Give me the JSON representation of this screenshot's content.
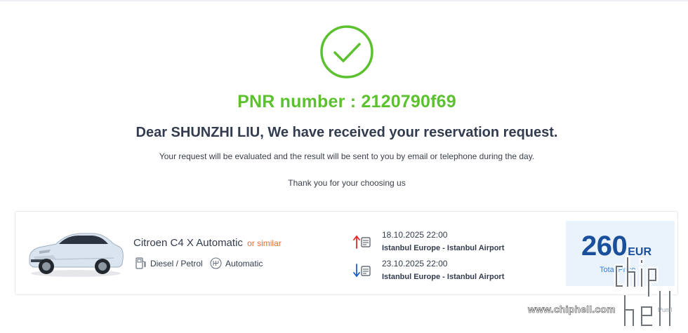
{
  "status": {
    "icon": "check-circle-icon",
    "color": "#5cc12f"
  },
  "pnr": {
    "text": "PNR number : 2120790f69"
  },
  "messages": {
    "greeting": "Dear SHUNZHI LIU, We have received your reservation request.",
    "note": "Your request will be evaluated and the result will be sent to you by email or telephone during the day.",
    "thanks": "Thank you for your choosing us"
  },
  "reservation": {
    "car_image": "car-photo",
    "car_name": "Citroen C4 X Automatic",
    "or_similar": "or similar",
    "fuel": "Diesel / Petrol",
    "fuel_icon": "fuel-pump-icon",
    "transmission": "Automatic",
    "transmission_icon": "gearbox-icon",
    "pickup": {
      "icon": "pickup-arrow-icon",
      "datetime": "18.10.2025 22:00",
      "location": "Istanbul Europe - Istanbul Airport"
    },
    "dropoff": {
      "icon": "dropoff-arrow-icon",
      "datetime": "23.10.2025 22:00",
      "location": "Istanbul Europe - Istanbul Airport"
    },
    "price": {
      "amount": "260",
      "currency": "EUR",
      "label": "Total Price"
    }
  },
  "watermark": {
    "site": "www.chiphell.com",
    "small": "Puml"
  },
  "colors": {
    "accent_green": "#5cc12f",
    "text_dark": "#333c4e",
    "price_blue": "#1a4f9c",
    "label_blue": "#3b82d6",
    "similar_orange": "#f06a2c",
    "price_bg": "#eaf3fb"
  }
}
